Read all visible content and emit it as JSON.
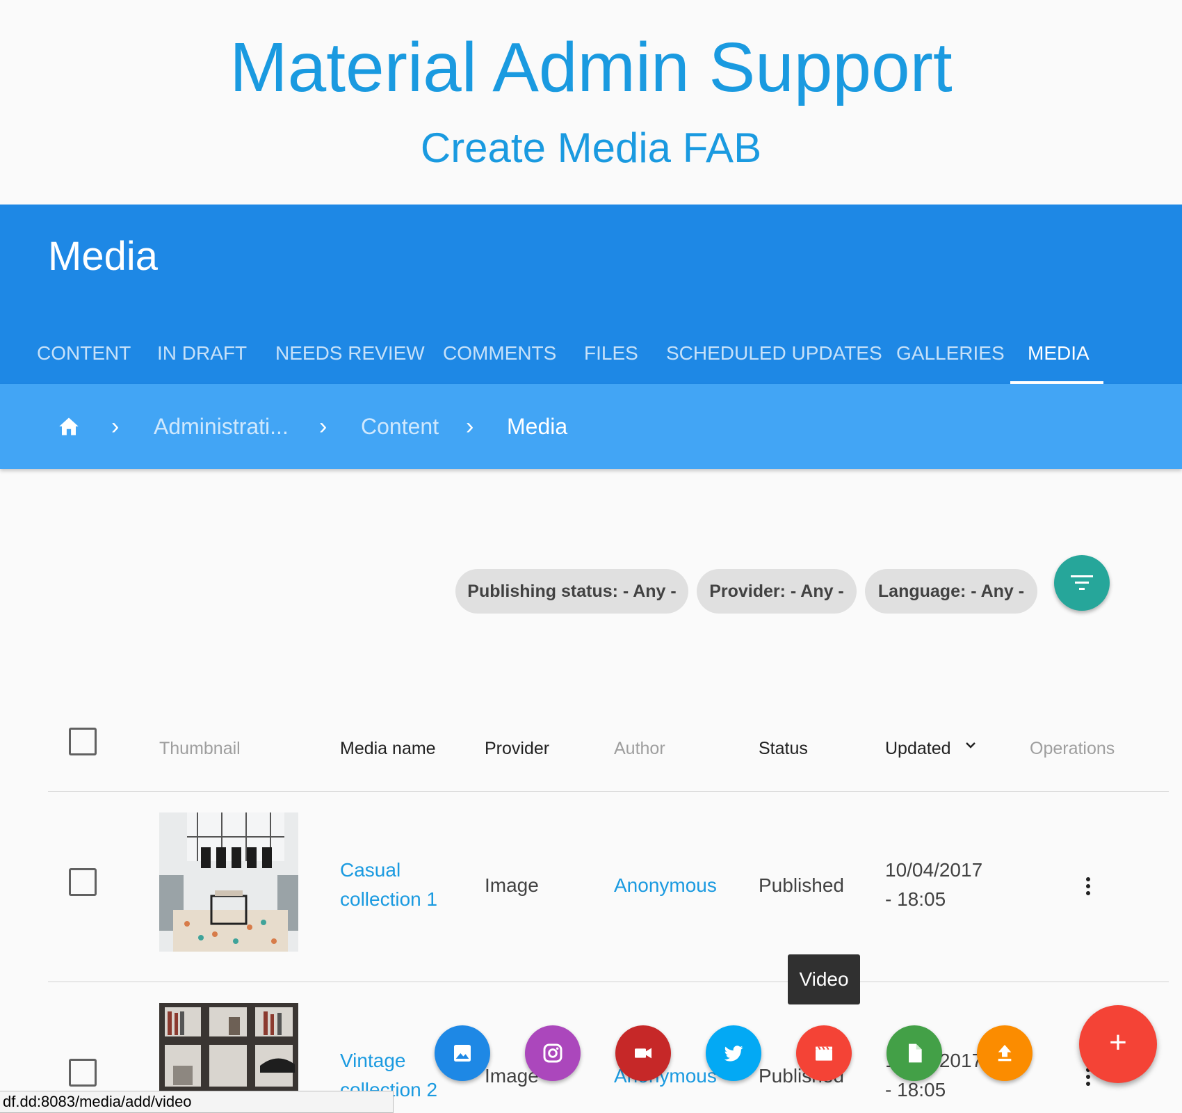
{
  "hero": {
    "title": "Material Admin Support",
    "subtitle": "Create Media FAB"
  },
  "appbar": {
    "title": "Media",
    "tabs": [
      {
        "label": "CONTENT"
      },
      {
        "label": "IN DRAFT"
      },
      {
        "label": "NEEDS REVIEW"
      },
      {
        "label": "COMMENTS"
      },
      {
        "label": "FILES"
      },
      {
        "label": "SCHEDULED UPDATES"
      },
      {
        "label": "GALLERIES"
      },
      {
        "label": "MEDIA"
      }
    ],
    "active_tab": "MEDIA"
  },
  "breadcrumb": {
    "home_icon": "home-icon",
    "items": [
      {
        "label": "Administrati..."
      },
      {
        "label": "Content"
      },
      {
        "label": "Media"
      }
    ]
  },
  "filters": {
    "chips": [
      {
        "label": "Publishing status: - Any -"
      },
      {
        "label": "Provider: - Any -"
      },
      {
        "label": "Language: - Any -"
      }
    ],
    "filter_icon": "filter-icon"
  },
  "table": {
    "headers": {
      "thumbnail": "Thumbnail",
      "media_name": "Media name",
      "provider": "Provider",
      "author": "Author",
      "status": "Status",
      "updated": "Updated",
      "operations": "Operations"
    },
    "rows": [
      {
        "name_line1": "Casual",
        "name_line2": "collection 1",
        "provider": "Image",
        "author": "Anonymous",
        "status": "Published",
        "updated_line1": "10/04/2017",
        "updated_line2": "- 18:05"
      },
      {
        "name_line1": "Vintage",
        "name_line2": "collection 2",
        "provider": "Image",
        "author": "Anonymous",
        "status": "Published",
        "updated_line1": "10/04/2017",
        "updated_line2": "- 18:05"
      }
    ]
  },
  "fab": {
    "tooltip": "Video",
    "main_label": "+",
    "actions": [
      {
        "icon": "image-icon",
        "color": "#1e88e5"
      },
      {
        "icon": "instagram-icon",
        "color": "#ab47bc"
      },
      {
        "icon": "video-camera-icon",
        "color": "#c62828"
      },
      {
        "icon": "twitter-icon",
        "color": "#03a9f4"
      },
      {
        "icon": "movie-icon",
        "color": "#f44336"
      },
      {
        "icon": "document-icon",
        "color": "#43a047"
      },
      {
        "icon": "upload-icon",
        "color": "#fb8c00"
      }
    ]
  },
  "statusbar": {
    "url": "df.dd:8083/media/add/video"
  }
}
